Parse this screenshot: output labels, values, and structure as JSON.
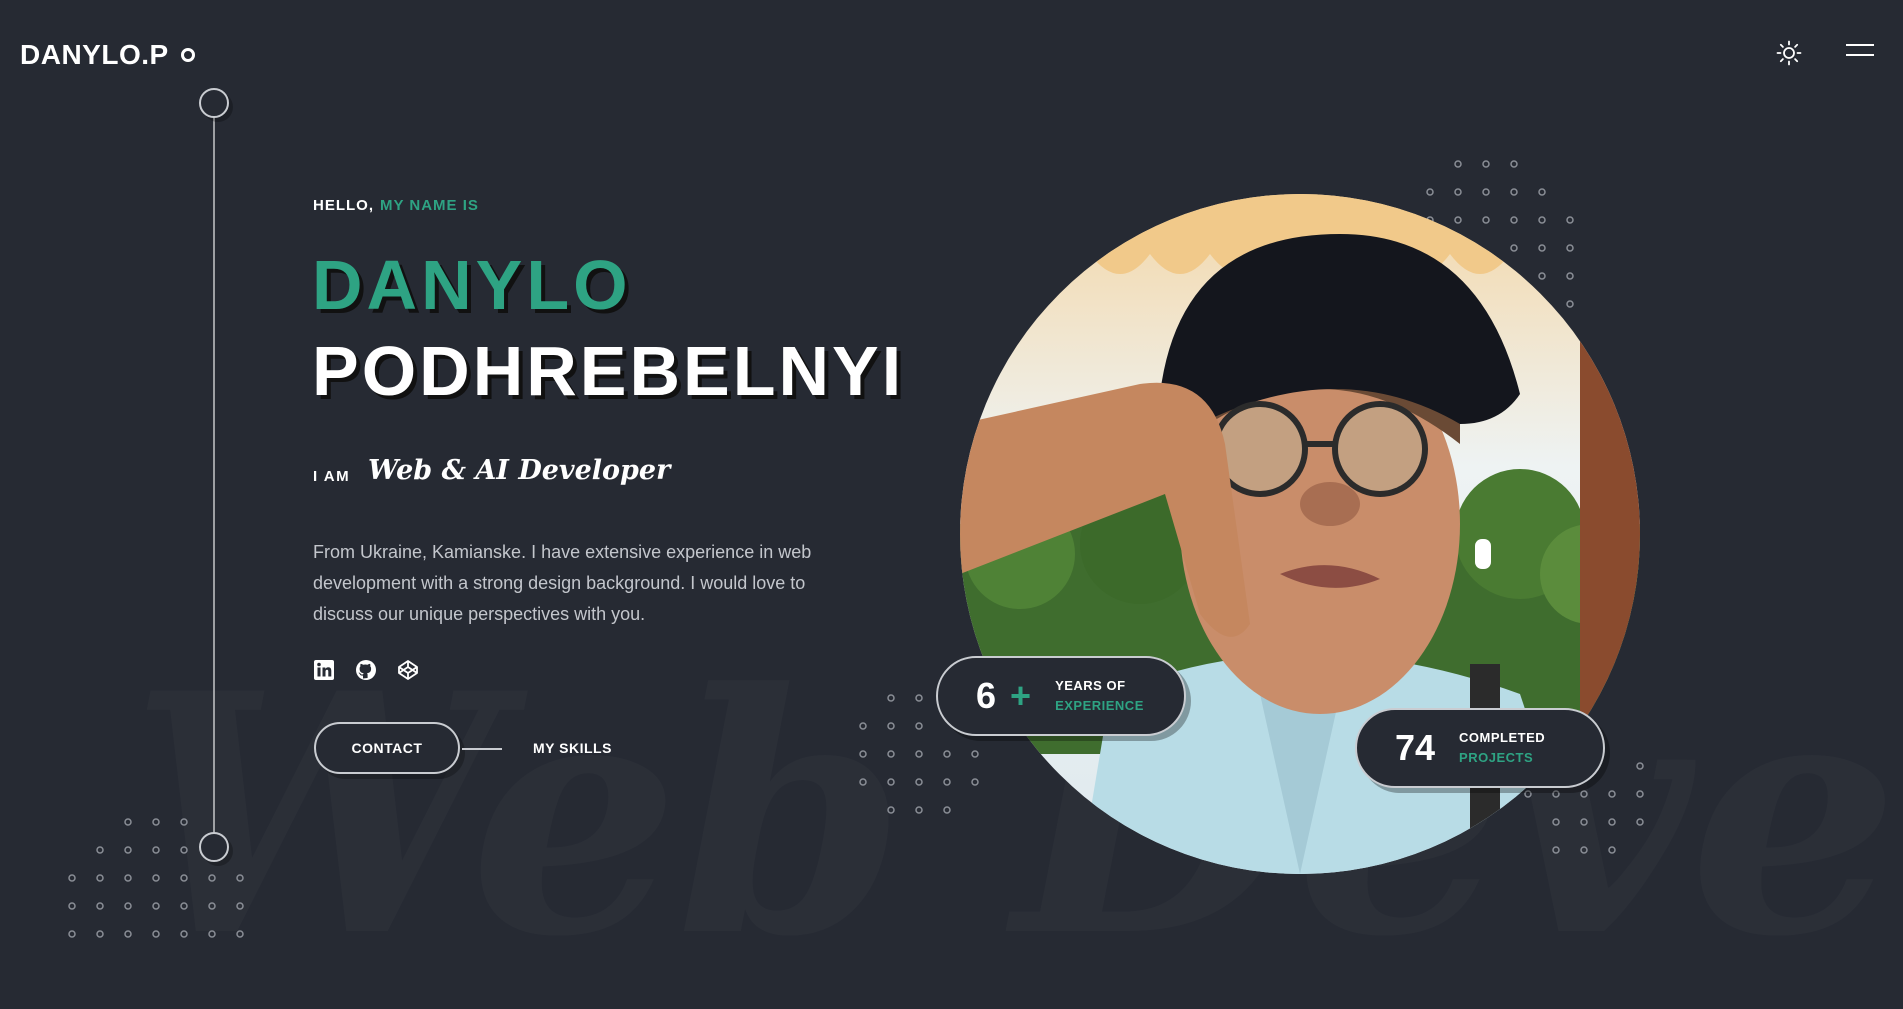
{
  "header": {
    "logo": "DANYLO.P",
    "theme_icon": "sun-icon",
    "menu_icon": "hamburger-menu-icon"
  },
  "hero": {
    "greeting": "HELLO,",
    "greeting_accent": "MY NAME IS",
    "first_name": "DANYLO",
    "last_name": "PODHREBELNYI",
    "iam": "I AM",
    "role": "Web & AI Developer",
    "bio": "From Ukraine, Kamianske. I have extensive experience in web development with a strong design background. I would love to discuss our unique perspectives with you.",
    "socials": [
      {
        "name": "linkedin-icon"
      },
      {
        "name": "github-icon"
      },
      {
        "name": "codepen-icon"
      }
    ],
    "contact_button": "CONTACT",
    "skills_link": "MY SKILLS",
    "background_text": "Web Developer"
  },
  "stats": [
    {
      "value": "6",
      "suffix": "+",
      "line1": "YEARS OF",
      "line2": "EXPERIENCE"
    },
    {
      "value": "74",
      "suffix": "",
      "line1": "COMPLETED",
      "line2": "PROJECTS"
    }
  ],
  "colors": {
    "background": "#262a33",
    "accent": "#2ea383",
    "text": "#ffffff"
  }
}
